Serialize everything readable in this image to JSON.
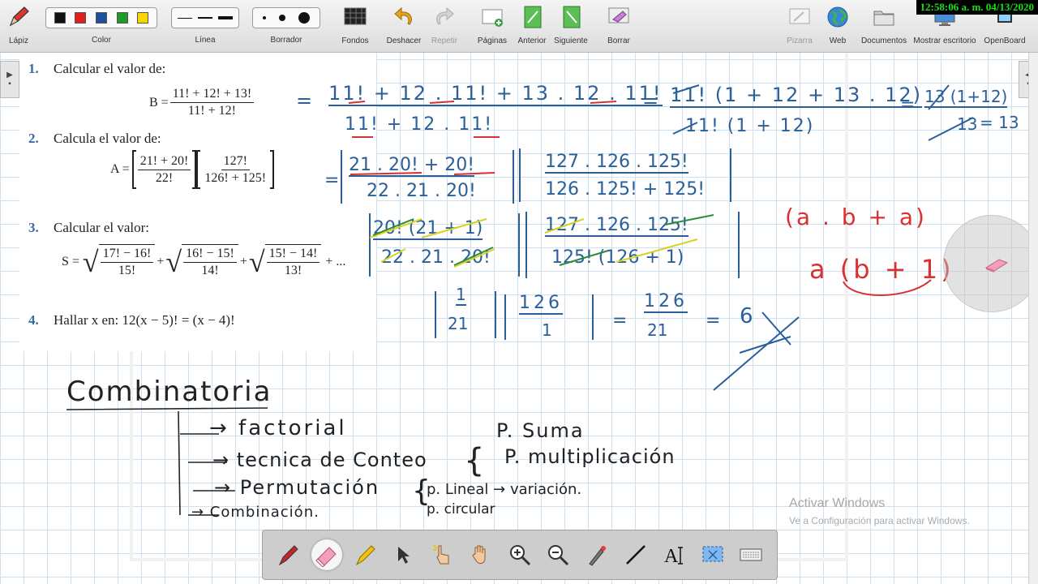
{
  "toolbar": {
    "pen": "Lápiz",
    "color": "Color",
    "line": "Línea",
    "eraser": "Borrador",
    "backgrounds": "Fondos",
    "undo": "Deshacer",
    "redo": "Repetir",
    "pages": "Páginas",
    "previous": "Anterior",
    "next": "Siguiente",
    "erase": "Borrar",
    "board": "Pizarra",
    "web": "Web",
    "documents": "Documentos",
    "show_desktop": "Mostrar escritorio",
    "openboard": "OpenBoard",
    "colors": [
      "#111111",
      "#e02020",
      "#1f4f9a",
      "#1e9a2a",
      "#f5d800"
    ]
  },
  "clock": "12:58:06 a. m. 04/13/2020",
  "worksheet": {
    "p1": {
      "num": "1.",
      "text": "Calcular el valor de:",
      "lhs": "B =",
      "num_expr": "11! + 12! + 13!",
      "den_expr": "11! + 12!"
    },
    "p2": {
      "num": "2.",
      "text": "Calcula el valor de:",
      "lhs": "A =",
      "f1_num": "21! + 20!",
      "f1_den": "22!",
      "f2_num": "127!",
      "f2_den": "126! + 125!"
    },
    "p3": {
      "num": "3.",
      "text": "Calcular el valor:",
      "lhs": "S =",
      "r1_num": "17! − 16!",
      "r1_den": "15!",
      "r2_num": "16! − 15!",
      "r2_den": "14!",
      "r3_num": "15! − 14!",
      "r3_den": "13!",
      "plus": "+",
      "tail": "+ ..."
    },
    "p4": {
      "num": "4.",
      "text": "Hallar x en: 12(x − 5)! = (x − 4)!"
    }
  },
  "ink": {
    "l1_top": "11! + 12 . 11! + 13 . 12 . 11!",
    "l1_bottom": "11! + 12 . 11!",
    "l1_eq1": "=",
    "l1_r_top": "11! (1 + 12 + 13 . 12)",
    "l1_r_bottom": "11! (1 + 12)",
    "l1_eq2": "=",
    "l1_res_top": "13 (1+12)",
    "l1_res_bottom": "13",
    "l1_res_val": "= 13",
    "l2_eq": "=",
    "l2_f1_top": "21 . 20! + 20!",
    "l2_f1_bottom": "22 . 21 . 20!",
    "l2_f2_top": "127 . 126 . 125!",
    "l2_f2_bottom": "126 . 125! + 125!",
    "l3_f1_top": "20! (21 + 1)",
    "l3_f1_bottom": "22 . 21 . 20!",
    "l3_f2_top": "127 . 126 . 125!",
    "l3_f2_bottom": "125! (126 + 1)",
    "l4_f1_top": "1",
    "l4_f1_bottom": "21",
    "l4_f2_top": "126",
    "l4_f2_bottom": "1",
    "l4_eq1": "=",
    "l4_mid_top": "126",
    "l4_mid_bottom": "21",
    "l4_eq2": "=",
    "l4_result": "6",
    "red1": "(a . b + a)",
    "red2": "a (b + 1)",
    "title": "Combinatoria",
    "b1": "→ factorial",
    "b2": "→ tecnica de Conteo",
    "b2a": "P. Suma",
    "b2b": "P. multiplicación",
    "b3": "→ Permutación",
    "b3a": "p. Lineal → variación.",
    "b3b": "p. circular",
    "b4": "→ Combinación."
  },
  "watermark": {
    "title": "Activar Windows",
    "subtitle": "Ve a Configuración para activar Windows."
  }
}
